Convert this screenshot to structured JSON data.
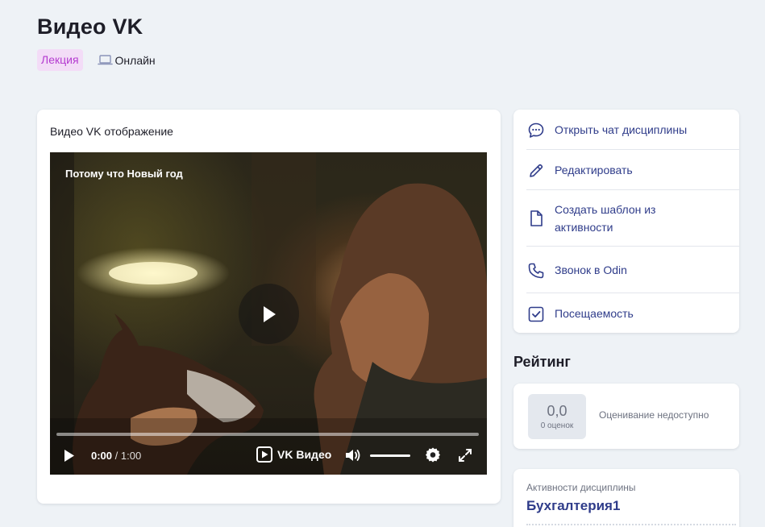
{
  "page": {
    "title": "Видео VK",
    "type_badge": "Лекция",
    "format_label": "Онлайн",
    "colors": {
      "accent": "#2f3c8a",
      "badge_bg": "#f3dcf7",
      "badge_text": "#b43bd0",
      "page_bg": "#eef2f6"
    }
  },
  "video_card": {
    "title": "Видео VK отображение",
    "player": {
      "caption": "Потому что Новый год",
      "current_time": "0:00",
      "separator": " / ",
      "duration": "1:00",
      "brand": "VK Видео",
      "progress": 0,
      "volume": 1
    }
  },
  "actions": [
    {
      "label": "Открыть чат дисциплины",
      "icon": "chat-icon"
    },
    {
      "label": "Редактировать",
      "icon": "pencil-icon"
    },
    {
      "label": "Создать шаблон из активности",
      "icon": "document-icon"
    },
    {
      "label": "Звонок в Odin",
      "icon": "phone-icon"
    },
    {
      "label": "Посещаемость",
      "icon": "checkbox-icon"
    }
  ],
  "rating": {
    "heading": "Рейтинг",
    "score": "0,0",
    "count_label": "0 оценок",
    "note": "Оценивание недоступно"
  },
  "discipline": {
    "label": "Активности дисциплины",
    "name": "Бухгалтерия1"
  }
}
